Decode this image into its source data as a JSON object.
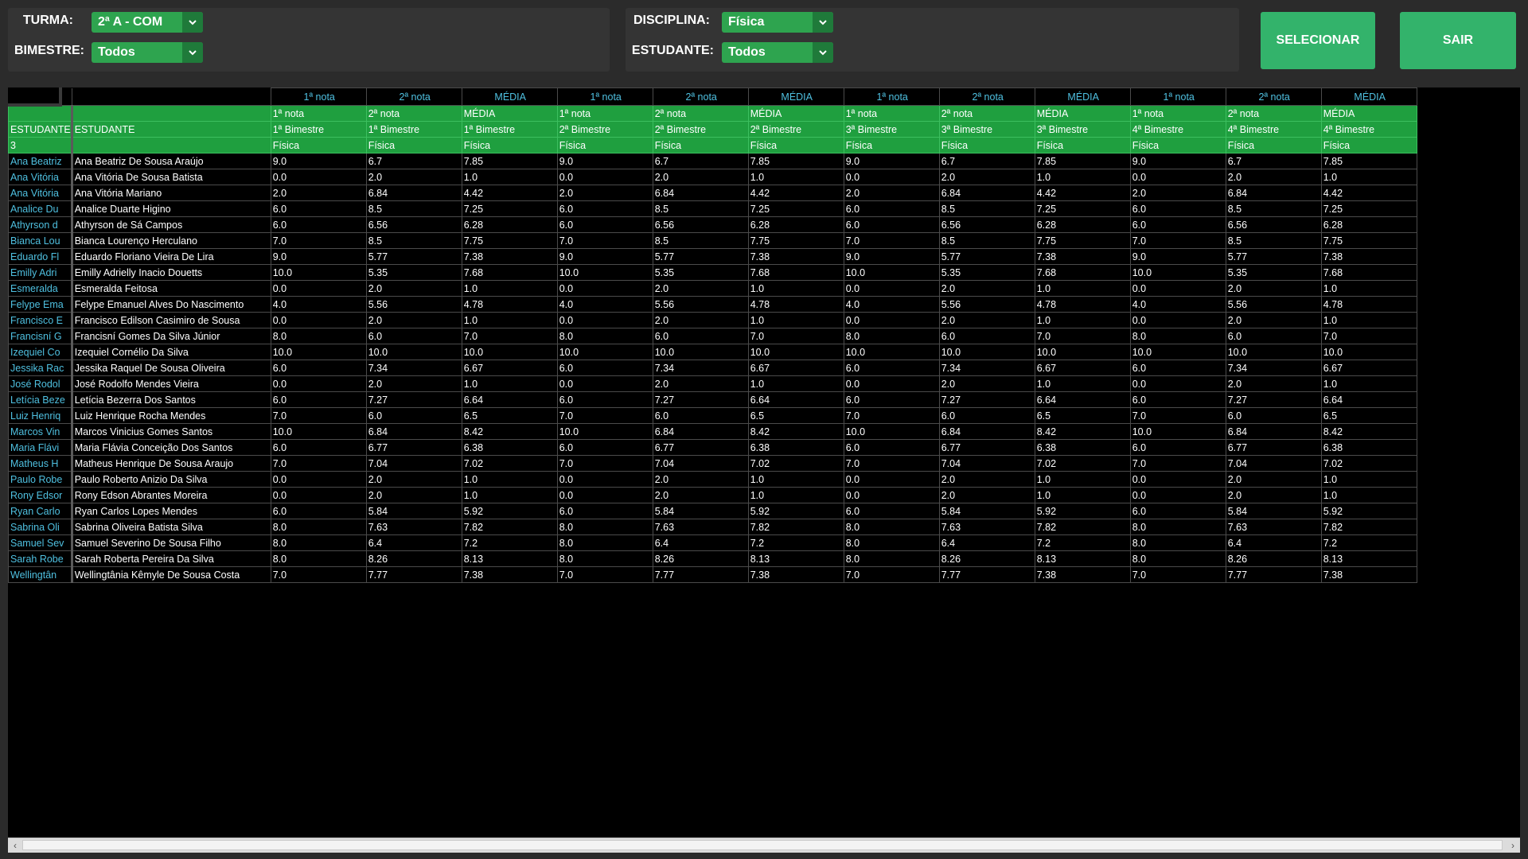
{
  "filters": {
    "turma_label": "TURMA:",
    "turma_value": "2ª A - COM",
    "bimestre_label": "BIMESTRE:",
    "bimestre_value": "Todos",
    "disciplina_label": "DISCIPLINA:",
    "disciplina_value": "Física",
    "estudante_label": "ESTUDANTE:",
    "estudante_value": "Todos"
  },
  "buttons": {
    "selecionar": "SELECIONAR",
    "sair": "SAIR"
  },
  "grid": {
    "top_headers": [
      "1ª nota",
      "2ª nota",
      "MÉDIA",
      "1ª nota",
      "2ª nota",
      "MÉDIA",
      "1ª nota",
      "2ª nota",
      "MÉDIA",
      "1ª nota",
      "2ª nota",
      "MÉDIA"
    ],
    "header_row1": [
      "",
      "",
      "1ª nota",
      "2ª nota",
      "MÉDIA",
      "1ª nota",
      "2ª nota",
      "MÉDIA",
      "1ª nota",
      "2ª nota",
      "MÉDIA",
      "1ª nota",
      "2ª nota",
      "MÉDIA"
    ],
    "header_row2": [
      "ESTUDANTE",
      "ESTUDANTE",
      "1ª Bimestre",
      "1ª Bimestre",
      "1ª Bimestre",
      "2ª Bimestre",
      "2ª Bimestre",
      "2ª Bimestre",
      "3ª Bimestre",
      "3ª Bimestre",
      "3ª Bimestre",
      "4ª Bimestre",
      "4ª Bimestre",
      "4ª Bimestre"
    ],
    "header_row3": [
      "3",
      "",
      "Física",
      "Física",
      "Física",
      "Física",
      "Física",
      "Física",
      "Física",
      "Física",
      "Física",
      "Física",
      "Física",
      "Física"
    ],
    "rows": [
      [
        "Ana Beatriz",
        "Ana Beatriz De Sousa Araújo",
        "9.0",
        "6.7",
        "7.85"
      ],
      [
        "Ana Vitória",
        "Ana Vitória De Sousa Batista",
        "0.0",
        "2.0",
        "1.0"
      ],
      [
        "Ana Vitória",
        "Ana Vitória Mariano",
        "2.0",
        "6.84",
        "4.42"
      ],
      [
        "Analice Du",
        "Analice Duarte Higino",
        "6.0",
        "8.5",
        "7.25"
      ],
      [
        "Athyrson d",
        "Athyrson de Sá Campos",
        "6.0",
        "6.56",
        "6.28"
      ],
      [
        "Bianca Lou",
        "Bianca Lourenço Herculano",
        "7.0",
        "8.5",
        "7.75"
      ],
      [
        "Eduardo Fl",
        "Eduardo Floriano Vieira De Lira",
        "9.0",
        "5.77",
        "7.38"
      ],
      [
        "Emilly Adri",
        "Emilly Adrielly Inacio Douetts",
        "10.0",
        "5.35",
        "7.68"
      ],
      [
        "Esmeralda",
        "Esmeralda Feitosa",
        "0.0",
        "2.0",
        "1.0"
      ],
      [
        "Felype Ema",
        "Felype Emanuel Alves Do Nascimento",
        "4.0",
        "5.56",
        "4.78"
      ],
      [
        "Francisco E",
        "Francisco Edilson Casimiro de Sousa",
        "0.0",
        "2.0",
        "1.0"
      ],
      [
        "Francisní G",
        "Francisní Gomes Da Silva Júnior",
        "8.0",
        "6.0",
        "7.0"
      ],
      [
        "Izequiel Co",
        "Izequiel Cornélio Da Silva",
        "10.0",
        "10.0",
        "10.0"
      ],
      [
        "Jessika Rac",
        "Jessika Raquel De Sousa Oliveira",
        "6.0",
        "7.34",
        "6.67"
      ],
      [
        "José Rodol",
        "José Rodolfo Mendes Vieira",
        "0.0",
        "2.0",
        "1.0"
      ],
      [
        "Letícia Beze",
        "Letícia Bezerra Dos Santos",
        "6.0",
        "7.27",
        "6.64"
      ],
      [
        "Luiz Henriq",
        "Luiz Henrique Rocha Mendes",
        "7.0",
        "6.0",
        "6.5"
      ],
      [
        "Marcos Vin",
        "Marcos Vinicius Gomes Santos",
        "10.0",
        "6.84",
        "8.42"
      ],
      [
        "Maria Flávi",
        "Maria Flávia Conceição Dos Santos",
        "6.0",
        "6.77",
        "6.38"
      ],
      [
        "Matheus H",
        "Matheus Henrique De Sousa Araujo",
        "7.0",
        "7.04",
        "7.02"
      ],
      [
        "Paulo Robe",
        "Paulo Roberto Anizio Da Silva",
        "0.0",
        "2.0",
        "1.0"
      ],
      [
        "Rony Edsor",
        "Rony Edson Abrantes Moreira",
        "0.0",
        "2.0",
        "1.0"
      ],
      [
        "Ryan Carlo",
        "Ryan Carlos Lopes Mendes",
        "6.0",
        "5.84",
        "5.92"
      ],
      [
        "Sabrina Oli",
        "Sabrina Oliveira Batista Silva",
        "8.0",
        "7.63",
        "7.82"
      ],
      [
        "Samuel Sev",
        "Samuel Severino De Sousa Filho",
        "8.0",
        "6.4",
        "7.2"
      ],
      [
        "Sarah Robe",
        "Sarah Roberta Pereira Da Silva",
        "8.0",
        "8.26",
        "8.13"
      ],
      [
        "Wellingtân",
        "Wellingtânia Kêmyle De Sousa Costa",
        "7.0",
        "7.77",
        "7.38"
      ]
    ]
  },
  "icons": {
    "dropdown": "chevron-down-icon",
    "scroll_left": "arrow-left-icon",
    "scroll_right": "arrow-right-icon"
  },
  "colors": {
    "accent_green": "#2ea44f",
    "button_green": "#33b36b",
    "header_cyan": "#4fc0e0"
  }
}
